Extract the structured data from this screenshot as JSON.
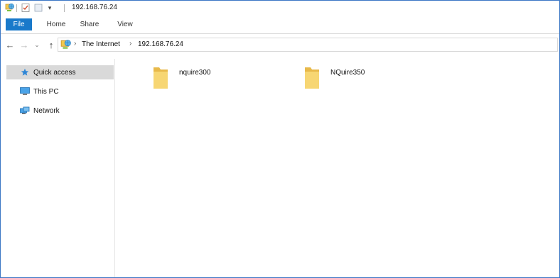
{
  "window": {
    "title": "192.168.76.24"
  },
  "titlebar": {
    "icons": [
      "network-location-icon",
      "properties-icon",
      "new-folder-icon",
      "customize-quick-access-icon"
    ]
  },
  "ribbon": {
    "tabs": [
      {
        "label": "File",
        "active": true
      },
      {
        "label": "Home"
      },
      {
        "label": "Share"
      },
      {
        "label": "View"
      }
    ]
  },
  "address_bar": {
    "breadcrumbs": [
      "The Internet",
      "192.168.76.24"
    ]
  },
  "nav_pane": {
    "items": [
      {
        "label": "Quick access",
        "icon": "star-icon",
        "selected": true
      },
      {
        "label": "This PC",
        "icon": "computer-icon"
      },
      {
        "label": "Network",
        "icon": "network-icon"
      }
    ]
  },
  "content": {
    "folders": [
      {
        "name": "nquire300"
      },
      {
        "name": "NQuire350"
      }
    ]
  },
  "colors": {
    "accent": "#1979ca",
    "selection": "#d9d9d9",
    "folder": "#f7d673",
    "window_border": "#3c77c5"
  }
}
